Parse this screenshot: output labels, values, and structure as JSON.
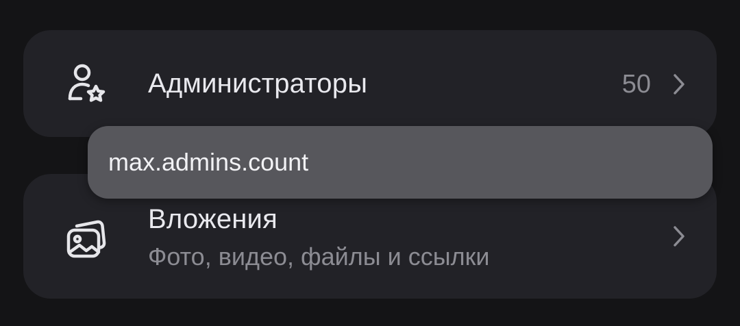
{
  "admins_row": {
    "icon": "admin-user-star-icon",
    "title": "Администраторы",
    "count": "50"
  },
  "attachments_row": {
    "icon": "gallery-images-icon",
    "title": "Вложения",
    "subtitle": "Фото, видео, файлы и ссылки"
  },
  "tooltip": {
    "text": "max.admins.count"
  },
  "colors": {
    "background": "#141416",
    "card": "#222227",
    "tooltip": "#57575c",
    "primary_text": "#e9e9ee",
    "secondary_text": "#8c8c93"
  }
}
